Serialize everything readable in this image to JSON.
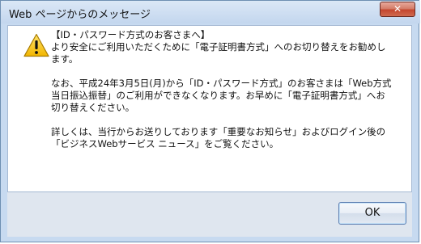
{
  "window": {
    "title": "Web ページからのメッセージ",
    "close_label": "✕"
  },
  "icon": "warning-icon",
  "message": {
    "paragraphs": [
      "【ID・パスワード方式のお客さまへ】\nより安全にご利用いただくために「電子証明書方式」へのお切り替えをお勧めします。",
      "なお、平成24年3月5日(月)から「ID・パスワード方式」のお客さまは「Web方式 当日振込振替」のご利用ができなくなります。お早めに「電子証明書方式」へお切り替えください。",
      "詳しくは、当行からお送りしております「重要なお知らせ」およびログイン後の「ビジネスWebサービス ニュース」をご覧ください。"
    ]
  },
  "buttons": {
    "ok_label": "OK"
  },
  "colors": {
    "frame": "#c7daf0",
    "close_button": "#c4462e",
    "footer": "#dfe6ef"
  }
}
